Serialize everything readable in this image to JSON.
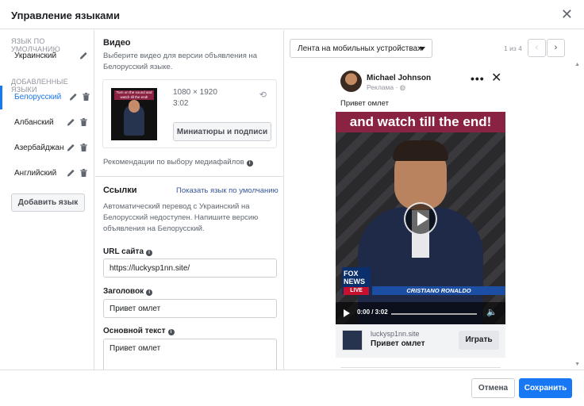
{
  "dialog": {
    "title": "Управление языками"
  },
  "sidebar": {
    "default_section": "ЯЗЫК ПО УМОЛЧАНИЮ",
    "default_language": "Украинский",
    "added_section": "ДОБАВЛЕННЫЕ ЯЗЫКИ",
    "added_languages": [
      {
        "label": "Белорусский",
        "active": true
      },
      {
        "label": "Албанский",
        "active": false
      },
      {
        "label": "Азербайджан…",
        "active": false
      },
      {
        "label": "Английский",
        "active": false
      }
    ],
    "add_language_button": "Добавить язык"
  },
  "video_section": {
    "heading": "Видео",
    "description": "Выберите видео для версии объявления на Белорусский языке.",
    "resolution": "1080 × 1920",
    "duration": "3:02",
    "thumbnail_caption": "Turn on the sound and watch till the end!",
    "thumbnails_button": "Миниатюры и подписи",
    "media_recommendations": "Рекомендации по выбору медиафайлов"
  },
  "links_section": {
    "heading": "Ссылки",
    "show_default_link": "Показать язык по умолчанию",
    "notice": "Автоматический перевод с Украинский на Белорусский недоступен. Напишите версию объявления на Белорусский.",
    "url_label": "URL сайта",
    "url_value": "https://luckysp1nn.site/",
    "headline_label": "Заголовок",
    "headline_value": "Привет омлет",
    "primary_text_label": "Основной текст",
    "primary_text_value": "Привет омлет"
  },
  "preview": {
    "placement": "Лента на мобильных устройствах",
    "pager": "1 из 4",
    "prev_arrow": "‹",
    "next_arrow": "›",
    "ad": {
      "user_name": "Michael Johnson",
      "sponsored": "Реклама",
      "caption": "Привет омлет",
      "video_banner": "and watch till the end!",
      "news_brand": "FOX NEWS",
      "news_live": "LIVE",
      "lower_third": "CRISTIANO RONALDO",
      "time": "0:00 / 3:02",
      "domain": "luckysp1nn.site",
      "headline": "Привет омлет",
      "cta": "Играть"
    }
  },
  "footer": {
    "cancel": "Отмена",
    "save": "Сохранить"
  }
}
